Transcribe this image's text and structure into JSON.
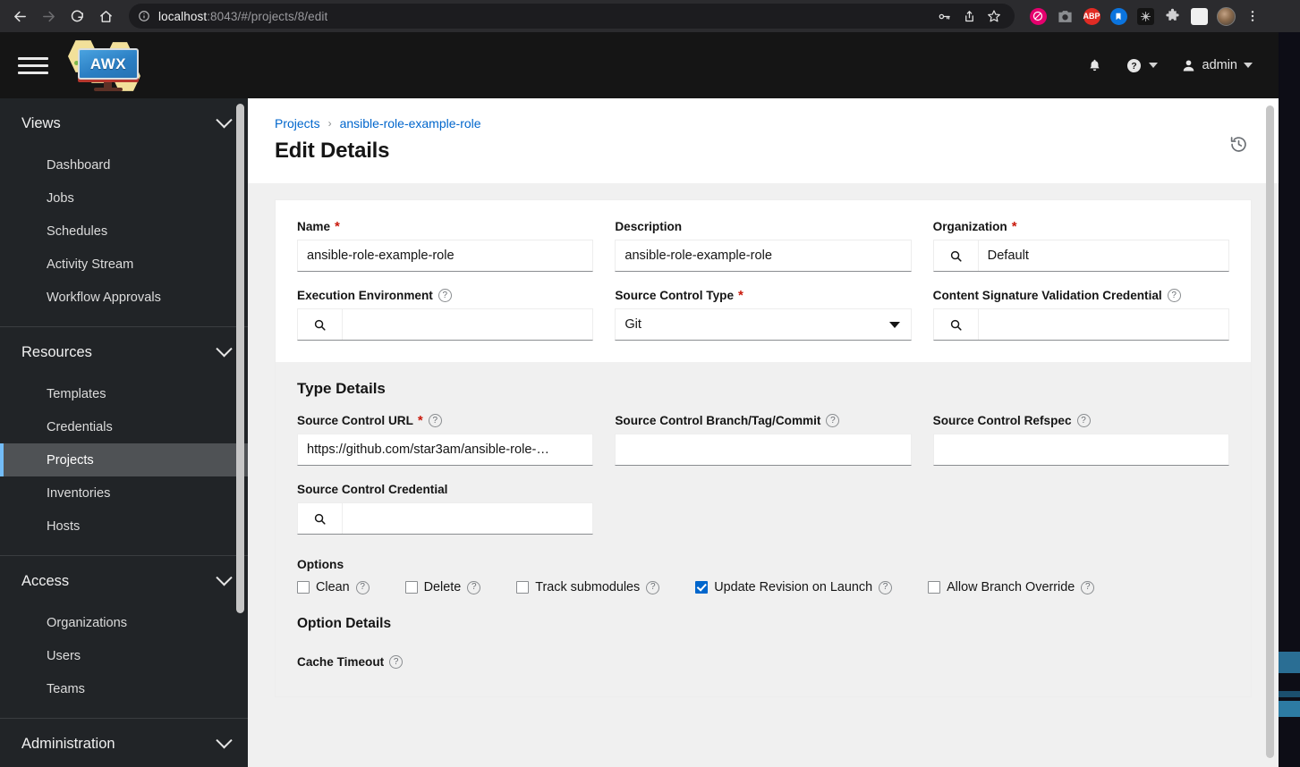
{
  "browser": {
    "url_prefix": "localhost",
    "url_rest": ":8043/#/projects/8/edit",
    "back_icon": "back-arrow-icon",
    "forward_icon": "forward-arrow-icon",
    "reload_icon": "reload-icon",
    "home_icon": "home-icon",
    "info_icon": "site-info-icon",
    "extensions": [
      {
        "name": "password-key-icon",
        "label": ""
      },
      {
        "name": "share-icon",
        "label": ""
      },
      {
        "name": "bookmark-star-icon",
        "label": ""
      },
      {
        "name": "privacy-badger-icon",
        "label": "",
        "color": "#e5006e"
      },
      {
        "name": "screenshot-camera-icon",
        "label": "",
        "color": "#8a8d90"
      },
      {
        "name": "adblock-plus-icon",
        "label": "ABP",
        "color": "#e12b24"
      },
      {
        "name": "pocket-bookmark-icon",
        "label": "",
        "color": "#0b74de"
      },
      {
        "name": "spider-web-icon",
        "label": "",
        "color": "#1b1b1b"
      },
      {
        "name": "extensions-puzzle-icon",
        "label": "",
        "color": "#cfcfd1"
      },
      {
        "name": "sidebar-toggle-icon",
        "label": "",
        "color": "#f0f0f0"
      }
    ],
    "profile_icon": "profile-avatar-icon",
    "menu_icon": "browser-menu-icon"
  },
  "masthead": {
    "menu_icon": "hamburger-menu-icon",
    "logo_text": "AWX",
    "notifications_icon": "bell-icon",
    "help_icon": "help-circle-icon",
    "user_icon": "user-icon",
    "username": "admin"
  },
  "sidebar": {
    "sections": [
      {
        "title": "Views",
        "items": [
          {
            "label": "Dashboard",
            "active": false
          },
          {
            "label": "Jobs",
            "active": false
          },
          {
            "label": "Schedules",
            "active": false
          },
          {
            "label": "Activity Stream",
            "active": false
          },
          {
            "label": "Workflow Approvals",
            "active": false
          }
        ]
      },
      {
        "title": "Resources",
        "items": [
          {
            "label": "Templates",
            "active": false
          },
          {
            "label": "Credentials",
            "active": false
          },
          {
            "label": "Projects",
            "active": true
          },
          {
            "label": "Inventories",
            "active": false
          },
          {
            "label": "Hosts",
            "active": false
          }
        ]
      },
      {
        "title": "Access",
        "items": [
          {
            "label": "Organizations",
            "active": false
          },
          {
            "label": "Users",
            "active": false
          },
          {
            "label": "Teams",
            "active": false
          }
        ]
      },
      {
        "title": "Administration",
        "items": []
      }
    ]
  },
  "page": {
    "breadcrumb": {
      "root": "Projects",
      "separator": "›",
      "current": "ansible-role-example-role"
    },
    "title": "Edit Details",
    "history_icon": "history-clock-icon"
  },
  "form": {
    "name": {
      "label": "Name",
      "required": true,
      "value": "ansible-role-example-role"
    },
    "description": {
      "label": "Description",
      "required": false,
      "value": "ansible-role-example-role"
    },
    "organization": {
      "label": "Organization",
      "required": true,
      "value": "Default",
      "search_icon": "search-icon"
    },
    "execution_environment": {
      "label": "Execution Environment",
      "required": false,
      "has_help": true,
      "value": "",
      "search_icon": "search-icon"
    },
    "source_control_type": {
      "label": "Source Control Type",
      "required": true,
      "value": "Git",
      "caret_icon": "chevron-down-icon"
    },
    "content_signature_validation_credential": {
      "label": "Content Signature Validation Credential",
      "required": false,
      "has_help": true,
      "value": "",
      "search_icon": "search-icon"
    },
    "type_details_title": "Type Details",
    "source_control_url": {
      "label": "Source Control URL",
      "required": true,
      "has_help": true,
      "value": "https://github.com/star3am/ansible-role-…"
    },
    "source_control_branch": {
      "label": "Source Control Branch/Tag/Commit",
      "required": false,
      "has_help": true,
      "value": ""
    },
    "source_control_refspec": {
      "label": "Source Control Refspec",
      "required": false,
      "has_help": true,
      "value": ""
    },
    "source_control_credential": {
      "label": "Source Control Credential",
      "required": false,
      "has_help": false,
      "value": "",
      "search_icon": "search-icon"
    },
    "options_title": "Options",
    "options": [
      {
        "label": "Clean",
        "checked": false,
        "has_help": true
      },
      {
        "label": "Delete",
        "checked": false,
        "has_help": true
      },
      {
        "label": "Track submodules",
        "checked": false,
        "has_help": true
      },
      {
        "label": "Update Revision on Launch",
        "checked": true,
        "has_help": true
      },
      {
        "label": "Allow Branch Override",
        "checked": false,
        "has_help": true
      }
    ],
    "option_details_title": "Option Details",
    "cache_timeout": {
      "label": "Cache Timeout",
      "has_help": true
    }
  },
  "colors": {
    "accent_blue": "#0066cc",
    "required_red": "#c9190b",
    "sidebar_bg": "#212427",
    "masthead_bg": "#151515",
    "active_border": "#73bcf7"
  }
}
